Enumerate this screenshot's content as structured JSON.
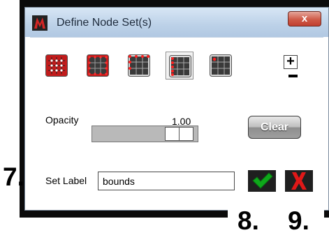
{
  "window": {
    "title": "Define Node Set(s)",
    "close_label": "x"
  },
  "toolbar": {
    "tools": [
      {
        "icon": "select-all-nodes-icon"
      },
      {
        "icon": "select-boundary-nodes-icon"
      },
      {
        "icon": "select-top-nodes-icon"
      },
      {
        "icon": "select-left-nodes-icon",
        "active": true
      },
      {
        "icon": "select-single-node-icon"
      }
    ],
    "add_label": "+"
  },
  "opacity": {
    "label": "Opacity",
    "value": "1.00",
    "level": 1.0
  },
  "clear_label": "Clear",
  "set_label": {
    "label": "Set Label",
    "value": "bounds"
  },
  "annotations": {
    "step_7": "7.",
    "step_8": "8.",
    "step_9": "9."
  },
  "colors": {
    "node_red": "#e3141b",
    "grid_dark": "#2c2c2c",
    "confirm_green": "#0ea81a",
    "cancel_red": "#e01818"
  }
}
